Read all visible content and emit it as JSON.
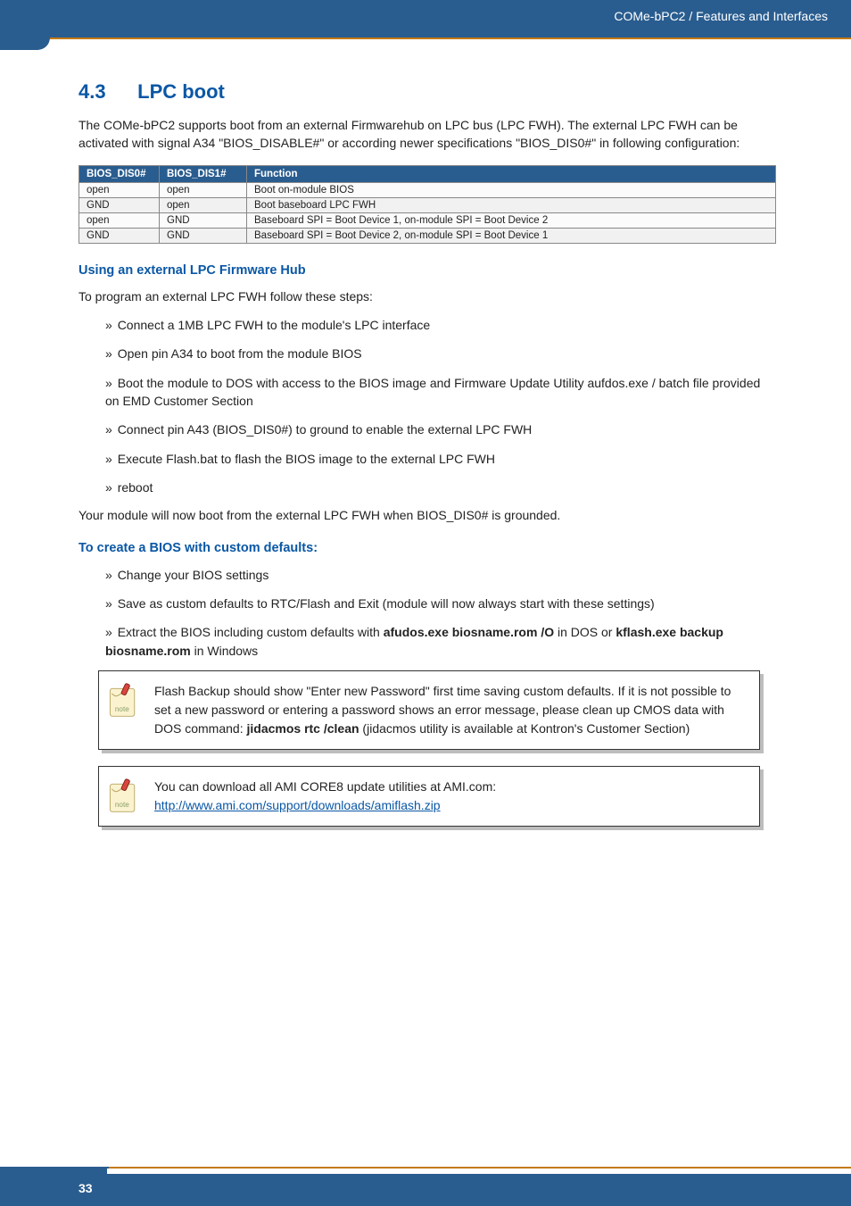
{
  "header": {
    "breadcrumb": "COMe-bPC2 / Features and Interfaces"
  },
  "section": {
    "number": "4.3",
    "title": "LPC boot",
    "intro": "The COMe-bPC2 supports boot from an external Firmwarehub on LPC bus (LPC FWH). The external LPC FWH can be activated with signal A34 \"BIOS_DISABLE#\" or according newer specifications \"BIOS_DIS0#\" in following configuration:"
  },
  "table": {
    "headers": [
      "BIOS_DIS0#",
      "BIOS_DIS1#",
      "Function"
    ],
    "rows": [
      [
        "open",
        "open",
        "Boot on-module BIOS"
      ],
      [
        "GND",
        "open",
        "Boot baseboard LPC FWH"
      ],
      [
        "open",
        "GND",
        "Baseboard SPI = Boot Device 1, on-module SPI = Boot Device 2"
      ],
      [
        "GND",
        "GND",
        "Baseboard SPI = Boot Device 2, on-module SPI = Boot Device 1"
      ]
    ]
  },
  "sub1": {
    "heading": "Using an external LPC Firmware Hub",
    "lead": "To program an external LPC FWH follow these steps:",
    "steps": [
      "Connect a 1MB LPC FWH to the module's LPC interface",
      "Open pin A34 to boot from the module BIOS",
      "Boot the module to DOS with access to the BIOS image and Firmware Update Utility aufdos.exe / batch file provided on EMD Customer Section",
      "Connect pin A43 (BIOS_DIS0#) to ground to enable the external LPC FWH",
      "Execute Flash.bat to flash the BIOS image to the external LPC FWH",
      "reboot"
    ],
    "closing": "Your module will now boot from the external LPC FWH when BIOS_DIS0# is grounded."
  },
  "sub2": {
    "heading": "To create a BIOS with custom defaults:",
    "steps": {
      "s1": "Change your BIOS settings",
      "s2": "Save as custom defaults to RTC/Flash and Exit (module will now always start with these settings)",
      "s3_pre": "Extract the BIOS including custom defaults with ",
      "s3_b1": "afudos.exe biosname.rom /O",
      "s3_mid": " in DOS or ",
      "s3_b2": "kflash.exe backup biosname.rom",
      "s3_post": " in Windows"
    }
  },
  "note1": {
    "pre": "Flash Backup should show \"Enter new Password\" first time saving custom defaults. If it is not possible to set a new password or entering a password shows an error message, please clean up CMOS data with DOS command: ",
    "cmd": "jidacmos rtc /clean",
    "post": " (jidacmos utility is available at Kontron's Customer Section)"
  },
  "note2": {
    "line1": "You can download all AMI CORE8 update utilities at AMI.com:",
    "url": "http://www.ami.com/support/downloads/amiflash.zip"
  },
  "footer": {
    "page": "33"
  },
  "glyph": {
    "raquo": "»"
  }
}
